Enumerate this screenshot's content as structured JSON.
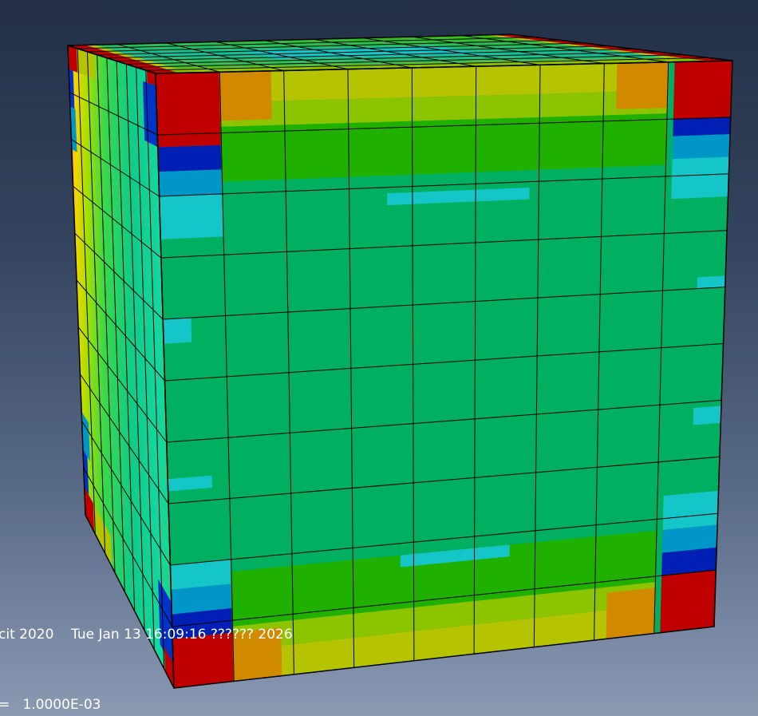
{
  "viewport": {
    "background_top": "#222f47",
    "background_bottom": "#8b9ab3"
  },
  "model": {
    "description_icon": "fea-cube-contour-mesh",
    "colors": {
      "red": "#c00000",
      "orange": "#d18a00",
      "yellow": "#b5c300",
      "yellowgreen": "#8cc400",
      "green": "#20b000",
      "mainfield": "#00af5f",
      "teal": "#00bb9e",
      "cyan": "#14c6c7",
      "lightblue": "#0096c8",
      "blue": "#0033c8",
      "deepblue": "#001fb4",
      "edge": "#000000"
    },
    "mesh_divisions": 9
  },
  "info": {
    "status_line": "cit 2020    Tue Jan 13 16:09:16 ?????? 2026",
    "increment_line": "=   1.0000E-03"
  }
}
